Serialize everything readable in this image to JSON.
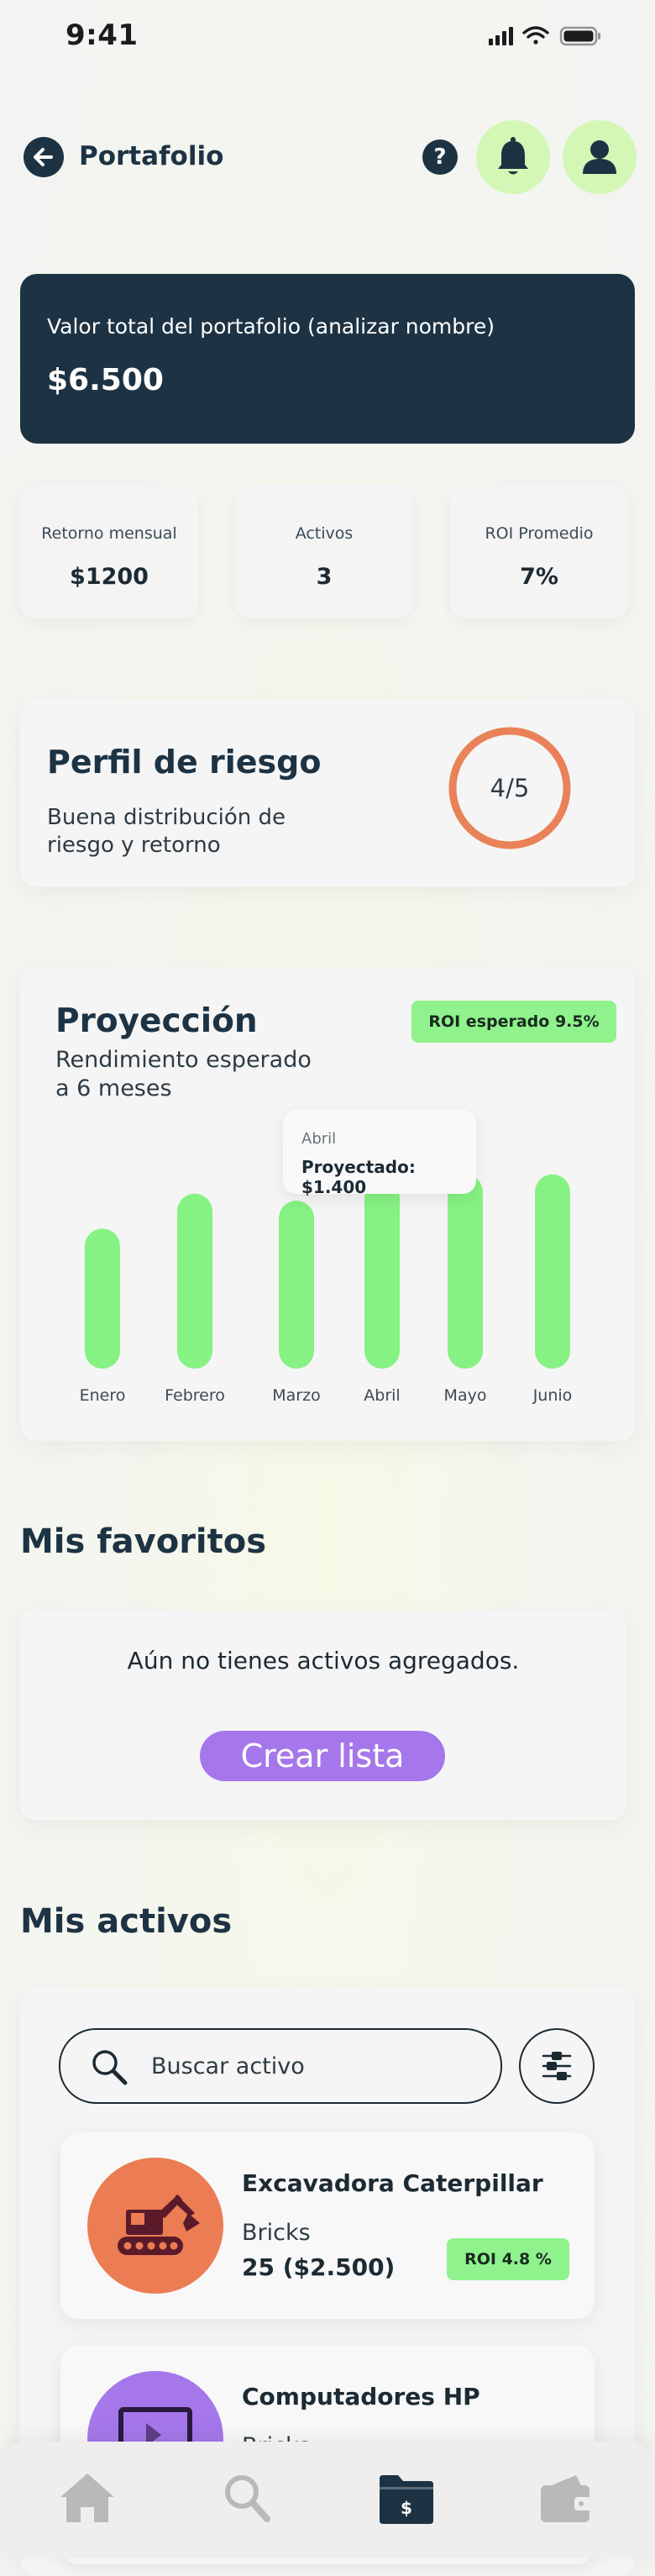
{
  "status_bar": {
    "time": "9:41"
  },
  "header": {
    "title": "Portafolio",
    "help_label": "?"
  },
  "total": {
    "label": "Valor total del portafolio (analizar nombre)",
    "value": "$6.500"
  },
  "stats": [
    {
      "label": "Retorno mensual",
      "value": "$1200"
    },
    {
      "label": "Activos",
      "value": "3"
    },
    {
      "label": "ROI Promedio",
      "value": "7%"
    }
  ],
  "risk": {
    "title": "Perfil de riesgo",
    "description": "Buena distribución de riesgo y retorno",
    "score": "4/5",
    "score_value": 4,
    "score_max": 5
  },
  "projection": {
    "title": "Proyección",
    "subtitle": "Rendimiento esperado a 6 meses",
    "roi_badge": "ROI esperado 9.5%",
    "tooltip": {
      "month": "Abril",
      "value": "Proyectado: $1.400"
    }
  },
  "chart_data": {
    "type": "bar",
    "categories": [
      "Enero",
      "Febrero",
      "Marzo",
      "Abril",
      "Mayo",
      "Junio"
    ],
    "values": [
      160,
      200,
      192,
      215,
      222,
      222
    ],
    "highlighted": "Abril",
    "ylim": [
      0,
      240
    ],
    "grid": false,
    "color": "#86f283"
  },
  "favorites": {
    "title": "Mis favoritos",
    "empty_text": "Aún no tienes activos agregados.",
    "create_label": "Crear lista"
  },
  "assets": {
    "title": "Mis activos",
    "search_placeholder": "Buscar activo",
    "items": [
      {
        "name": "Excavadora Caterpillar",
        "platform": "Bricks",
        "amount": "25 ($2.500)",
        "roi": "ROI 4.8 %",
        "icon": "excavator-icon",
        "color": "#ec7c53"
      },
      {
        "name": "Computadores HP",
        "platform": "Bricks",
        "icon": "computer-icon",
        "color": "#a577ea"
      }
    ]
  },
  "nav": {
    "items": [
      "home-icon",
      "search-icon",
      "portfolio-icon",
      "wallet-icon"
    ],
    "active": "portfolio-icon"
  },
  "colors": {
    "primary": "#1d3344",
    "accent_green": "#8ff28d",
    "light_green": "#d4f7b6",
    "purple": "#a577ea",
    "orange": "#ec7c53"
  }
}
